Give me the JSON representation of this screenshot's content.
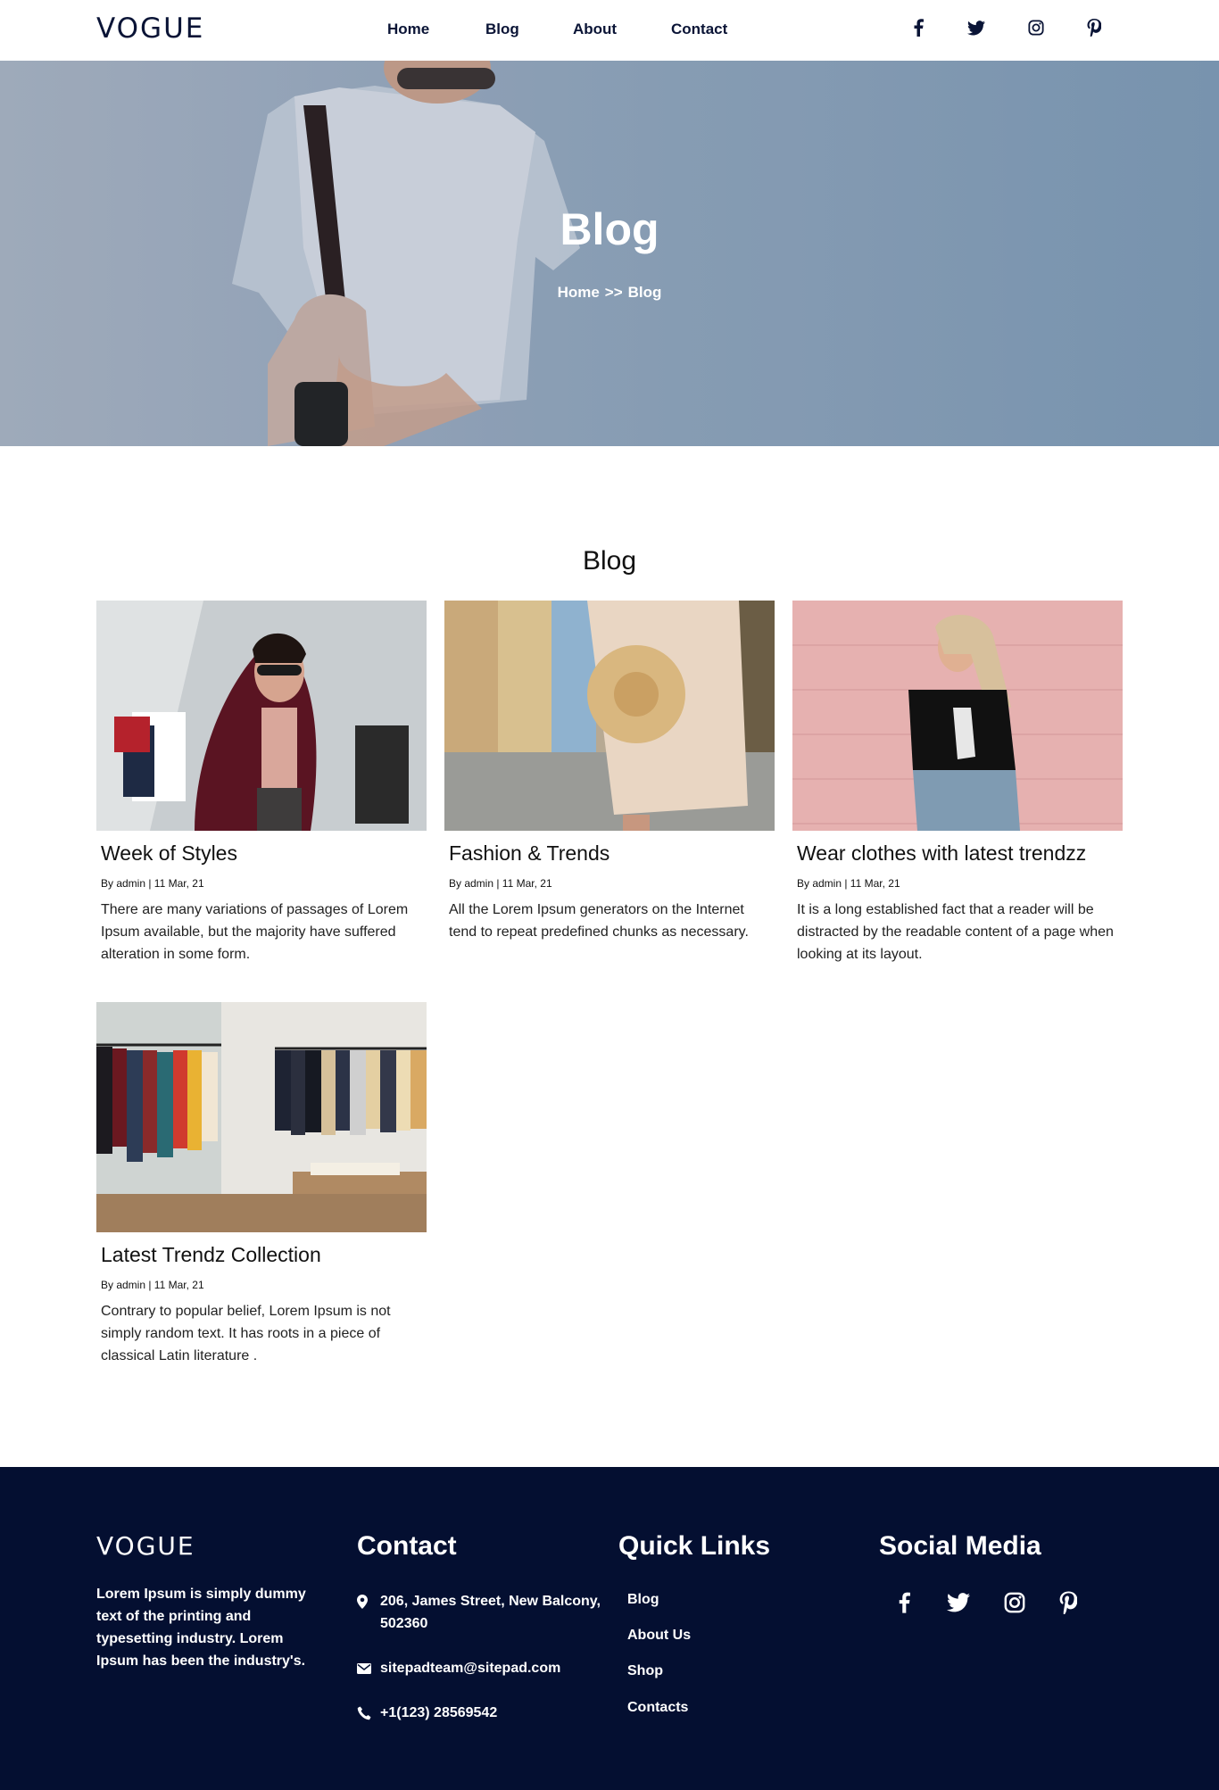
{
  "header": {
    "logo": "VOGUE",
    "nav": [
      "Home",
      "Blog",
      "About",
      "Contact"
    ],
    "social_icons": [
      "facebook-icon",
      "twitter-icon",
      "instagram-icon",
      "pinterest-icon"
    ]
  },
  "hero": {
    "title": "Blog",
    "breadcrumb_home": "Home",
    "breadcrumb_sep": ">>",
    "breadcrumb_current": "Blog"
  },
  "blog": {
    "section_title": "Blog",
    "posts": [
      {
        "title": "Week of Styles",
        "meta": "By admin | 11 Mar, 21",
        "text": "There are many variations of passages of Lorem Ipsum available, but the majority have suffered alteration in some form."
      },
      {
        "title": "Fashion & Trends",
        "meta": "By admin | 11 Mar, 21",
        "text": "All the Lorem Ipsum generators on the Internet tend to repeat predefined chunks as necessary."
      },
      {
        "title": "Wear clothes with latest trendzz",
        "meta": "By admin | 11 Mar, 21",
        "text": "It is a long established fact that a reader will be distracted by the readable content of a page when looking at its layout."
      },
      {
        "title": "Latest Trendz Collection",
        "meta": "By admin | 11 Mar, 21",
        "text": "Contrary to popular belief, Lorem Ipsum is not simply random text. It has roots in a piece of classical Latin literature ."
      }
    ]
  },
  "footer": {
    "logo": "VOGUE",
    "about": "Lorem Ipsum is simply dummy text of the printing and typesetting industry. Lorem Ipsum has been the industry's.",
    "contact_title": "Contact",
    "address": "206, James Street, New Balcony, 502360",
    "email": "sitepadteam@sitepad.com",
    "phone": "+1(123) 28569542",
    "quick_links_title": "Quick Links",
    "quick_links": [
      "Blog",
      "About Us",
      "Shop",
      "Contacts"
    ],
    "social_title": "Social Media"
  },
  "colors": {
    "navy": "#0a1436",
    "footer_bg": "#040f31",
    "white": "#ffffff"
  }
}
